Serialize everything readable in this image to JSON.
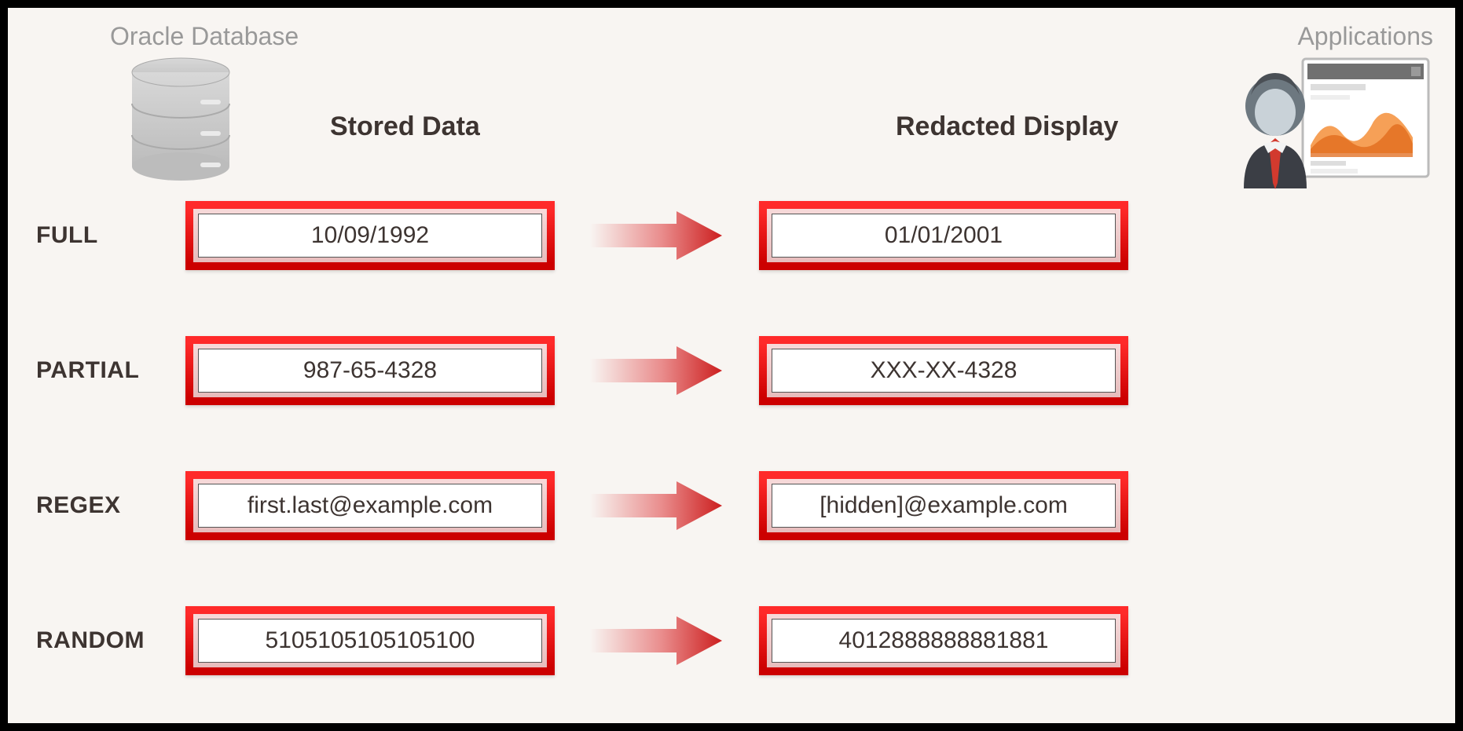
{
  "header": {
    "left_label": "Oracle Database",
    "right_label": "Applications",
    "stored_col": "Stored Data",
    "redacted_col": "Redacted Display"
  },
  "rows": [
    {
      "label": "FULL",
      "stored": "10/09/1992",
      "redacted": "01/01/2001"
    },
    {
      "label": "PARTIAL",
      "stored": "987-65-4328",
      "redacted": "XXX-XX-4328"
    },
    {
      "label": "REGEX",
      "stored": "first.last@example.com",
      "redacted": "[hidden]@example.com"
    },
    {
      "label": "RANDOM",
      "stored": "5105105105105100",
      "redacted": "4012888888881881"
    }
  ],
  "colors": {
    "frame_red_top": "#ff2a2a",
    "frame_red_bottom": "#cc0000",
    "bg": "#f8f5f2",
    "text": "#3d3431",
    "muted": "#999999"
  }
}
